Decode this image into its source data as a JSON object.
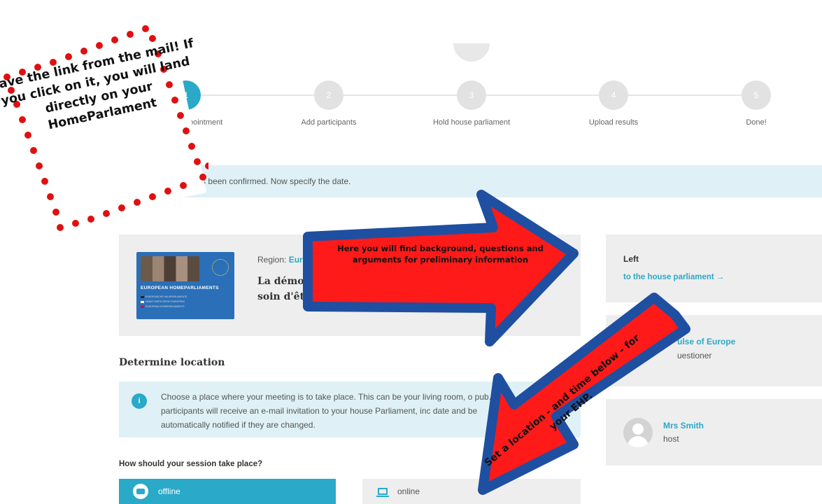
{
  "stepper": {
    "steps": [
      {
        "num": "1",
        "label": "To fix an appointment"
      },
      {
        "num": "2",
        "label": "Add participants"
      },
      {
        "num": "3",
        "label": "Hold house parliament"
      },
      {
        "num": "4",
        "label": "Upload results"
      },
      {
        "num": "5",
        "label": "Done!"
      }
    ]
  },
  "alert": {
    "text": "The registration has been confirmed. Now specify the date."
  },
  "module": {
    "region_label": "Region:",
    "region_value": "Euro",
    "title": "La démoc soin d'être",
    "thumbnail_title": "EUROPEAN HOMEPARLIAMENTS",
    "thumbnail_rows": [
      "EUROPÄISCHE HAUSPARLAMENTE",
      "DÉBAT PARTICIPATIF EUROPÉEN",
      "EUROPEAN HOMEPARLIAMENTS"
    ]
  },
  "sidebar": {
    "left_title": "Left",
    "left_link": "to the house parliament →",
    "pulse_name": "ulse of Europe",
    "pulse_role": "uestioner",
    "host_name": "Mrs Smith",
    "host_role": "host"
  },
  "location": {
    "heading": "Determine location",
    "info_icon": "i",
    "info_text": "Choose a place where your meeting is to take place. This can be your living room, o pub. The participants will receive an e-mail invitation to your house Parliament, inc date and be automatically notified if they are changed.",
    "session_question": "How should your session take place?",
    "offline_label": "offline",
    "online_label": "online"
  },
  "annotations": {
    "save_link_note": "Save the link from the mail! If you click on it, you will land directly on your HomeParlament",
    "arrow_right_note": "Here you will find background, questions and arguments for preliminary information",
    "arrow_down_note": "Set a location - and time below - for your EHP."
  },
  "colors": {
    "accent": "#2aa9c9",
    "arrow_fill": "#ff1a1a",
    "arrow_border": "#1f4fa0",
    "dots": "#e01010"
  }
}
